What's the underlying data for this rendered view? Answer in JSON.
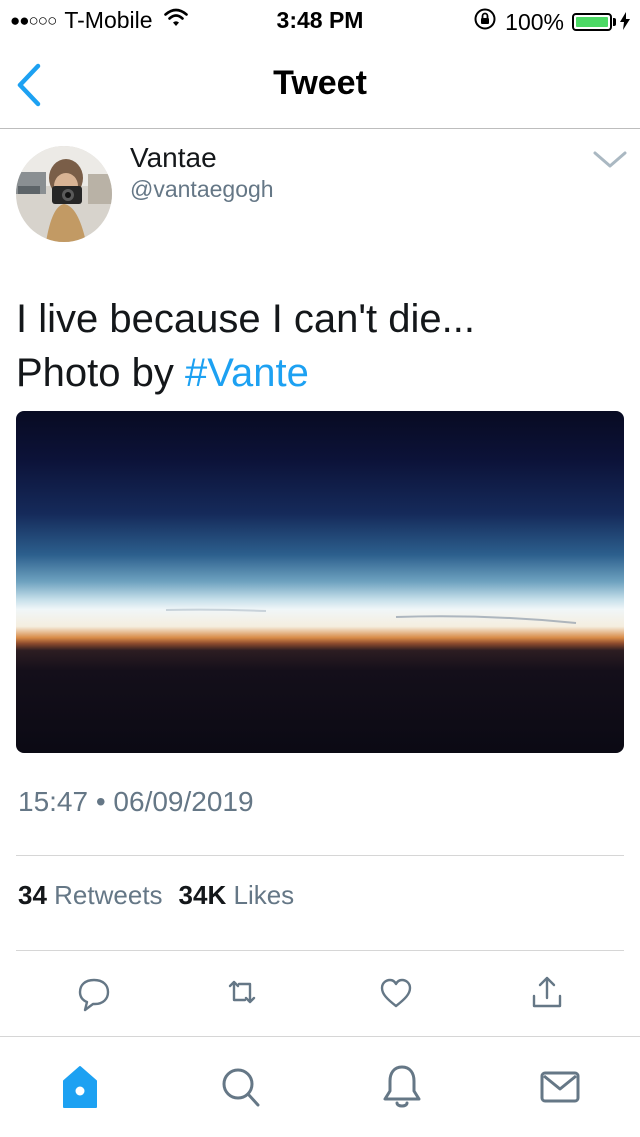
{
  "status_bar": {
    "signal": "●●○○○",
    "carrier": "T-Mobile",
    "time": "3:48 PM",
    "battery_percent": "100%",
    "battery_level": 1.0,
    "battery_color": "#4cd964"
  },
  "nav": {
    "title": "Tweet",
    "back_icon": "chevron-left-icon"
  },
  "tweet": {
    "author_name": "Vantae",
    "author_handle": "@vantaegogh",
    "text_line1": "I live because I can't die...",
    "text_line2_prefix": "Photo by ",
    "hashtag": "#Vante",
    "timestamp": "15:47 • 06/09/2019",
    "retweets_count": "34",
    "retweets_label": "Retweets",
    "likes_count": "34K",
    "likes_label": "Likes"
  },
  "actions": [
    "reply-icon",
    "retweet-icon",
    "like-icon",
    "share-icon"
  ],
  "tabs": [
    "home-icon",
    "search-icon",
    "notifications-icon",
    "messages-icon"
  ],
  "colors": {
    "accent": "#1da1f2",
    "secondary_text": "#657786",
    "icon_gray": "#657786"
  }
}
